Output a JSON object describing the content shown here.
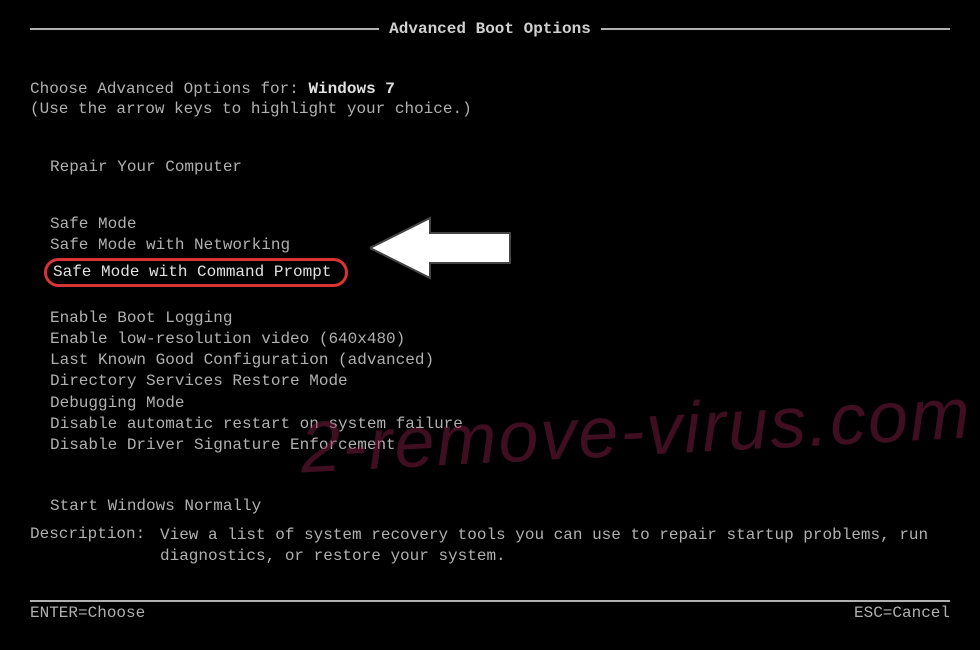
{
  "title": "Advanced Boot Options",
  "header": {
    "prefix": "Choose Advanced Options for: ",
    "os": "Windows 7",
    "hint": "(Use the arrow keys to highlight your choice.)"
  },
  "menu": {
    "repair": "Repair Your Computer",
    "safe_mode": "Safe Mode",
    "safe_mode_net": "Safe Mode with Networking",
    "safe_mode_cmd": "Safe Mode with Command Prompt",
    "boot_log": "Enable Boot Logging",
    "low_res": "Enable low-resolution video (640x480)",
    "lkgc": "Last Known Good Configuration (advanced)",
    "dsrm": "Directory Services Restore Mode",
    "debug": "Debugging Mode",
    "no_restart": "Disable automatic restart on system failure",
    "no_sig": "Disable Driver Signature Enforcement",
    "normal": "Start Windows Normally"
  },
  "description": {
    "label": "Description:",
    "text": "View a list of system recovery tools you can use to repair startup problems, run diagnostics, or restore your system."
  },
  "footer": {
    "enter": "ENTER=Choose",
    "esc": "ESC=Cancel"
  },
  "watermark": "2-remove-virus.com",
  "colors": {
    "highlight_border": "#d93333",
    "text": "#b0b0b0",
    "bg": "#000000"
  }
}
